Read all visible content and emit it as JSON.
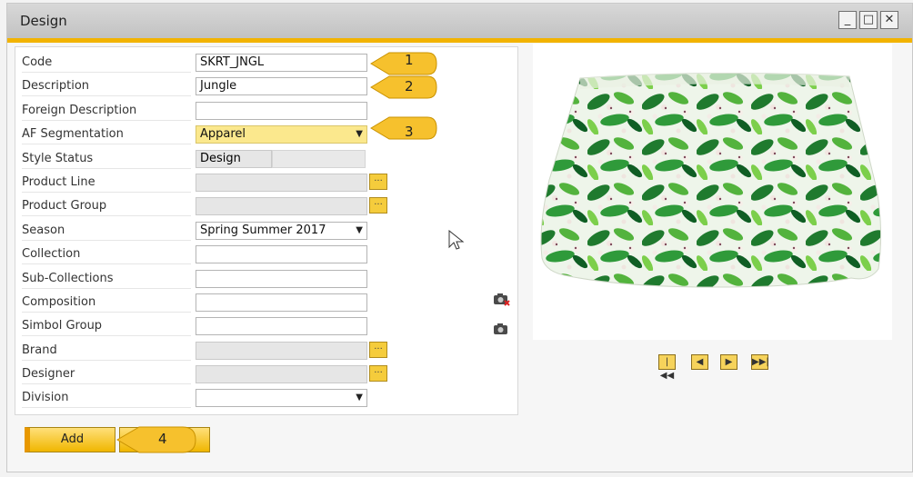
{
  "window": {
    "title": "Design",
    "controls": [
      "minimize-icon",
      "maximize-icon",
      "close-icon"
    ]
  },
  "form": {
    "rows": [
      {
        "label": "Code",
        "value": "SKRT_JNGL"
      },
      {
        "label": "Description",
        "value": "Jungle"
      },
      {
        "label": "Foreign Description",
        "value": ""
      },
      {
        "label": "AF Segmentation",
        "value": "Apparel"
      },
      {
        "label": "Style Status",
        "value": "Design"
      },
      {
        "label": "Product Line",
        "value": ""
      },
      {
        "label": "Product Group",
        "value": ""
      },
      {
        "label": "Season",
        "value": "Spring Summer 2017"
      },
      {
        "label": "Collection",
        "value": ""
      },
      {
        "label": "Sub-Collections",
        "value": ""
      },
      {
        "label": "Composition",
        "value": ""
      },
      {
        "label": "Simbol Group",
        "value": ""
      },
      {
        "label": "Brand",
        "value": ""
      },
      {
        "label": "Designer",
        "value": ""
      },
      {
        "label": "Division",
        "value": ""
      }
    ],
    "browse_label": "...",
    "dropdown_glyph": "▼"
  },
  "buttons": {
    "add": "Add",
    "cancel": ""
  },
  "callouts": {
    "c1": "1",
    "c2": "2",
    "c3": "3",
    "c4": "4"
  },
  "image_nav": {
    "first": "|◀◀",
    "prev": "◀",
    "next": "▶",
    "last": "▶▶|"
  },
  "colors": {
    "accent": "#f2b300",
    "field_highlight": "#fbe88d",
    "button": "#f0b600"
  }
}
